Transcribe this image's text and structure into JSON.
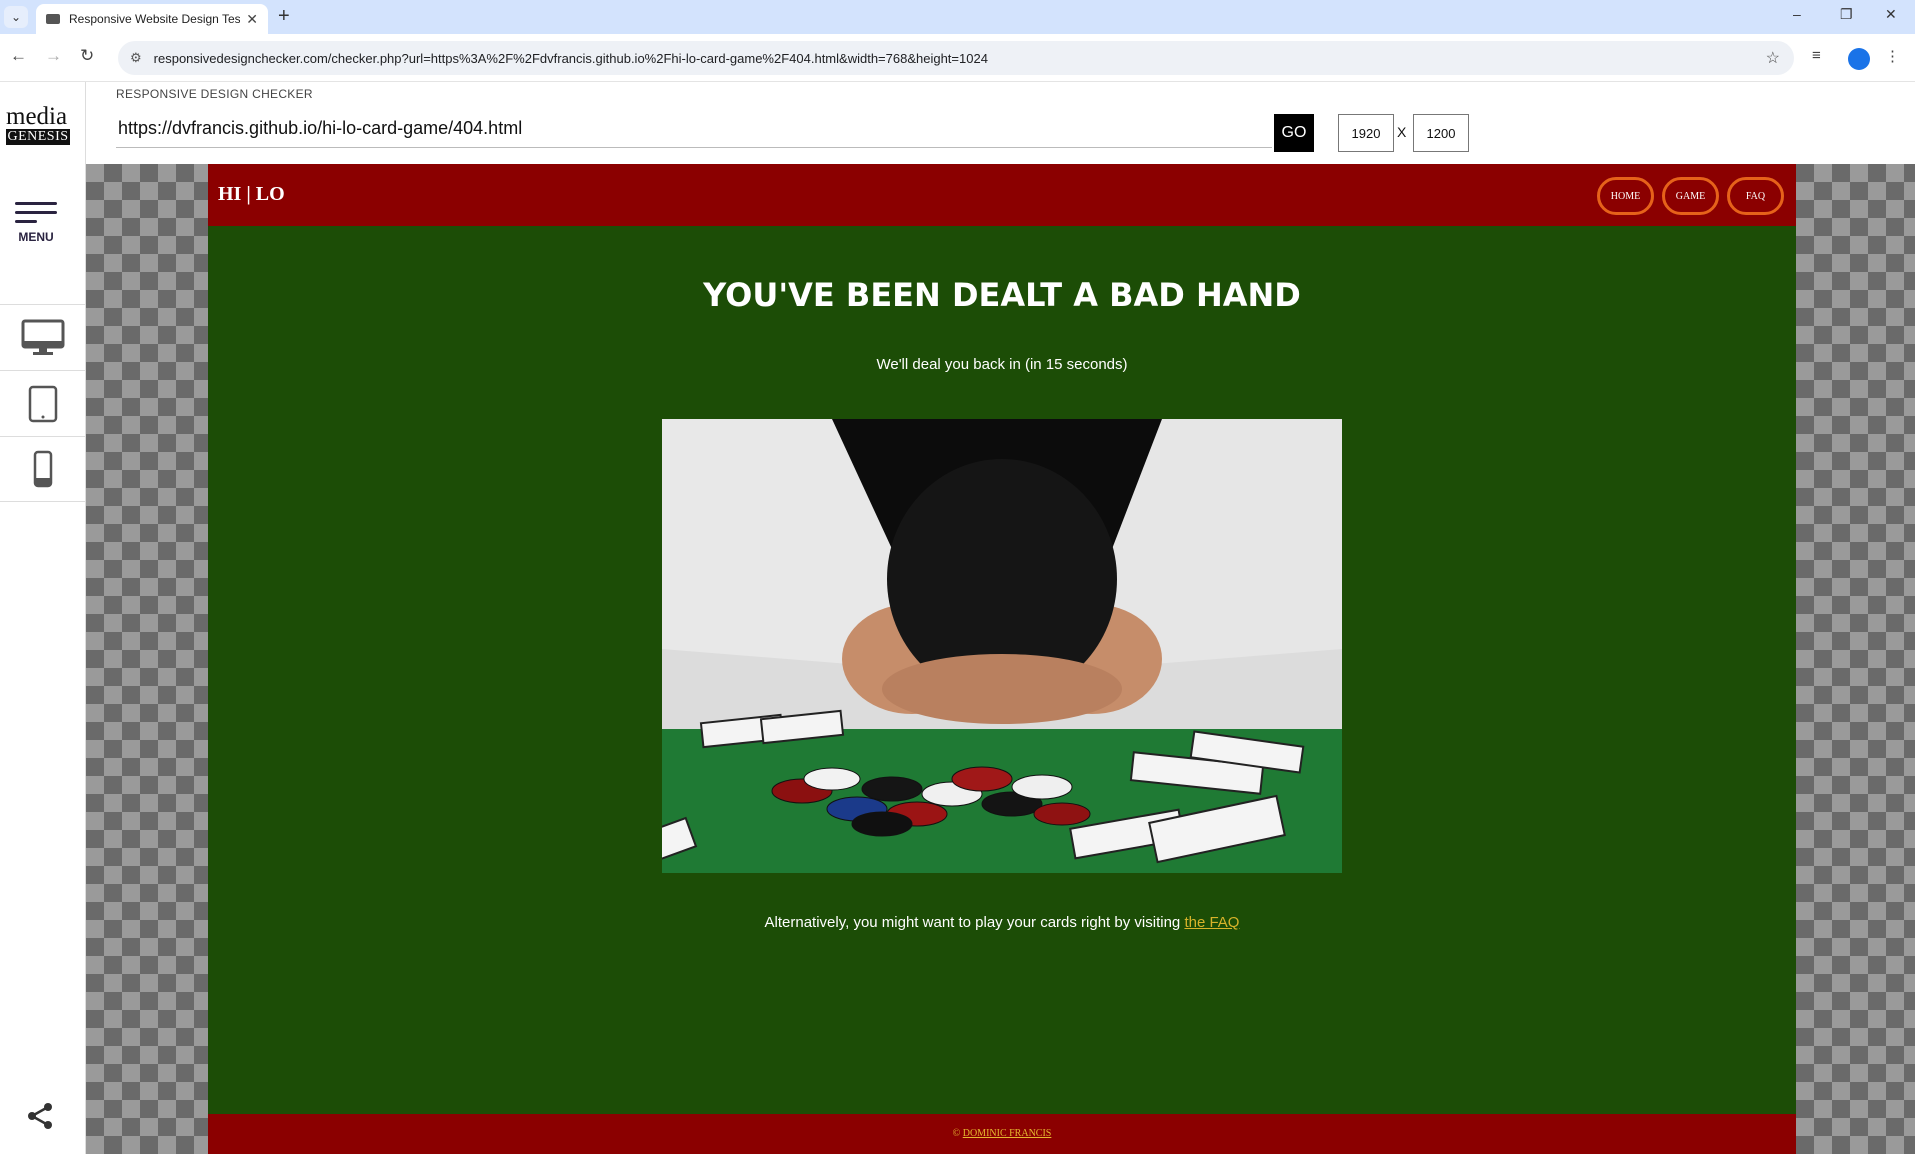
{
  "browser": {
    "tab_title": "Responsive Website Design Tes",
    "tab_close": "✕",
    "new_tab": "+",
    "address": "responsivedesignchecker.com/checker.php?url=https%3A%2F%2Fdvfrancis.github.io%2Fhi-lo-card-game%2F404.html&width=768&height=1024",
    "window_controls": {
      "minimize": "–",
      "restore": "❐",
      "close": "✕"
    }
  },
  "checker": {
    "logo_top": "media",
    "logo_bottom": "GENESIS",
    "menu_label": "MENU",
    "header": "RESPONSIVE DESIGN CHECKER",
    "url_value": "https://dvfrancis.github.io/hi-lo-card-game/404.html",
    "go_label": "GO",
    "width_value": "1920",
    "separator": "X",
    "height_value": "1200",
    "devices": [
      "desktop-icon",
      "tablet-icon",
      "phone-icon"
    ]
  },
  "site": {
    "brand": "HI | LO",
    "nav": [
      "HOME",
      "GAME",
      "FAQ"
    ],
    "headline": "YOU'VE BEEN DEALT A BAD HAND",
    "countdown": "We'll deal you back in (in 15 seconds)",
    "alt_text": "Alternatively, you might want to play your cards right by visiting",
    "faq_link": "the FAQ",
    "footer_symbol": "©",
    "footer_name": "DOMINIC FRANCIS",
    "colors": {
      "header": "#8b0000",
      "felt": "#1c4d06",
      "accent": "#e6621a",
      "link": "#d8b32a"
    }
  }
}
